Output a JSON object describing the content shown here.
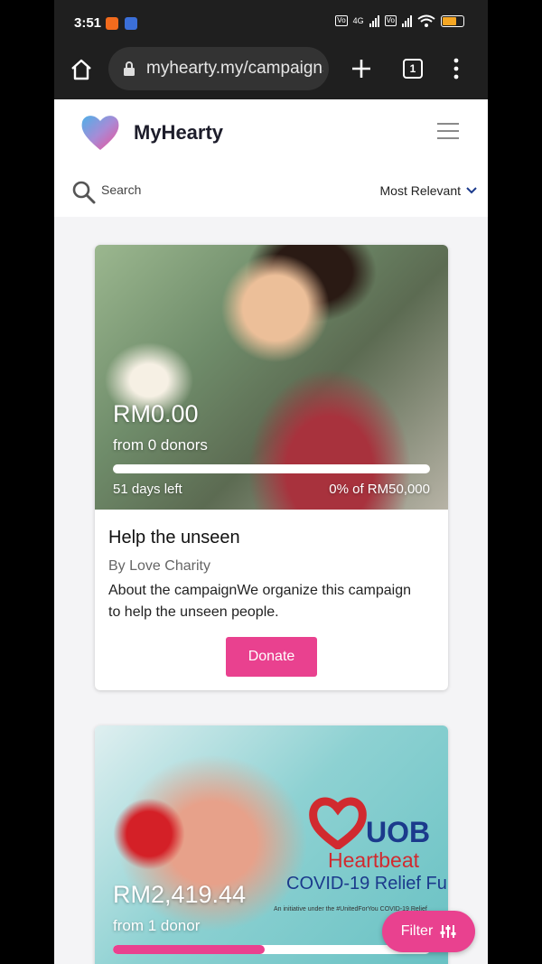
{
  "status_bar": {
    "time": "3:51",
    "network_label": "4G"
  },
  "browser": {
    "url": "myhearty.my/campaigns",
    "tab_count": "1"
  },
  "site": {
    "name": "MyHearty"
  },
  "search": {
    "placeholder": "Search",
    "sort_label": "Most Relevant"
  },
  "campaigns": [
    {
      "amount": "RM0.00",
      "donors": "from 0 donors",
      "days_left": "51 days left",
      "percent_of_goal": "0% of RM50,000",
      "progress": 0,
      "title": "Help the unseen",
      "organizer": "By Love Charity",
      "description": "About the campaignWe organize this campaign to help the unseen people.",
      "donate_label": "Donate"
    },
    {
      "amount": "RM2,419.44",
      "donors": "from 1 donor",
      "progress": 0.48,
      "image_text": {
        "brand": "UOB",
        "subtitle": "Heartbeat",
        "headline": "COVID-19 Relief Fu",
        "note": "An initiative under the #UnitedForYou COVID-19 Relief"
      }
    }
  ],
  "filter": {
    "label": "Filter"
  },
  "colors": {
    "accent": "#e9418f",
    "brand_blue": "#1b3a8c",
    "brand_red": "#d12a2f"
  }
}
